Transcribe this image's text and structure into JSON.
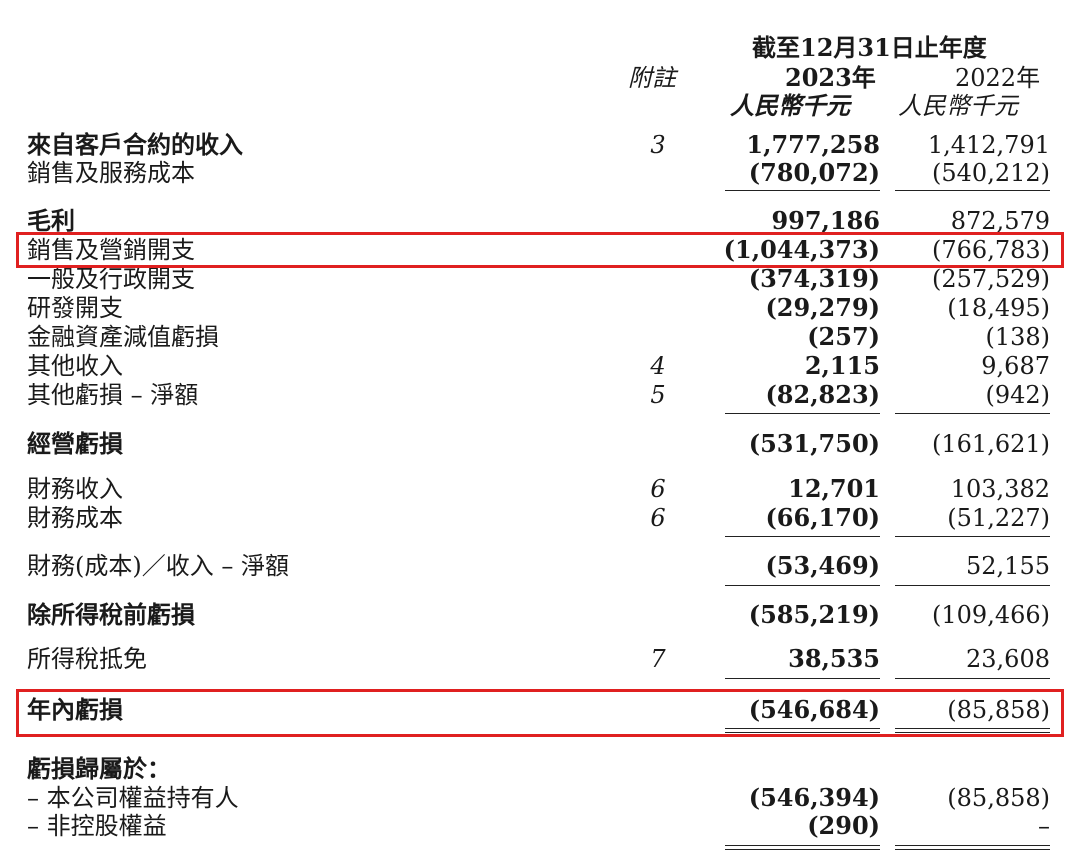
{
  "header": {
    "period": "截至12月31日止年度",
    "note_label": "附註",
    "year_2023": "2023年",
    "year_2022": "2022年",
    "unit_2023": "人民幣千元",
    "unit_2022": "人民幣千元"
  },
  "rows": [
    {
      "label": "來自客戶合約的收入",
      "note": "3",
      "v2023": "1,777,258",
      "v2022": "1,412,791"
    },
    {
      "label": "銷售及服務成本",
      "note": "",
      "v2023": "(780,072)",
      "v2022": "(540,212)"
    },
    {
      "label": "毛利",
      "note": "",
      "v2023": "997,186",
      "v2022": "872,579"
    },
    {
      "label": "銷售及營銷開支",
      "note": "",
      "v2023": "(1,044,373)",
      "v2022": "(766,783)"
    },
    {
      "label": "一般及行政開支",
      "note": "",
      "v2023": "(374,319)",
      "v2022": "(257,529)"
    },
    {
      "label": "研發開支",
      "note": "",
      "v2023": "(29,279)",
      "v2022": "(18,495)"
    },
    {
      "label": "金融資產減值虧損",
      "note": "",
      "v2023": "(257)",
      "v2022": "(138)"
    },
    {
      "label": "其他收入",
      "note": "4",
      "v2023": "2,115",
      "v2022": "9,687"
    },
    {
      "label": "其他虧損 – 淨額",
      "note": "5",
      "v2023": "(82,823)",
      "v2022": "(942)"
    },
    {
      "label": "經營虧損",
      "note": "",
      "v2023": "(531,750)",
      "v2022": "(161,621)"
    },
    {
      "label": "財務收入",
      "note": "6",
      "v2023": "12,701",
      "v2022": "103,382"
    },
    {
      "label": "財務成本",
      "note": "6",
      "v2023": "(66,170)",
      "v2022": "(51,227)"
    },
    {
      "label": "財務(成本)／收入 – 淨額",
      "note": "",
      "v2023": "(53,469)",
      "v2022": "52,155"
    },
    {
      "label": "除所得稅前虧損",
      "note": "",
      "v2023": "(585,219)",
      "v2022": "(109,466)"
    },
    {
      "label": "所得稅抵免",
      "note": "7",
      "v2023": "38,535",
      "v2022": "23,608"
    },
    {
      "label": "年內虧損",
      "note": "",
      "v2023": "(546,684)",
      "v2022": "(85,858)"
    },
    {
      "label": "虧損歸屬於：",
      "note": "",
      "v2023": "",
      "v2022": ""
    },
    {
      "label": "– 本公司權益持有人",
      "note": "",
      "v2023": "(546,394)",
      "v2022": "(85,858)"
    },
    {
      "label": "– 非控股權益",
      "note": "",
      "v2023": "(290)",
      "v2022": "–"
    }
  ],
  "highlight_color": "#e02020"
}
